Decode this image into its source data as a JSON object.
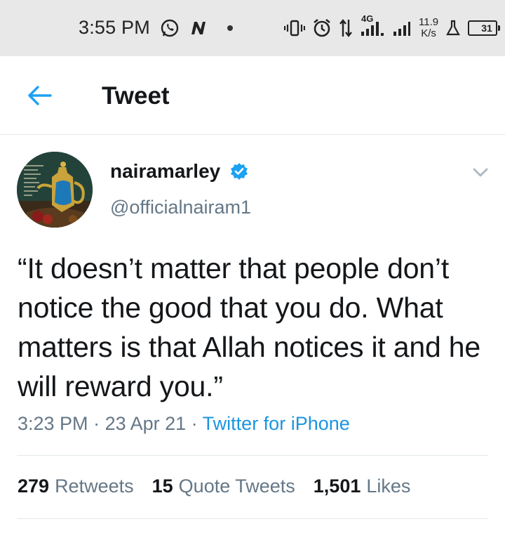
{
  "status_bar": {
    "time": "3:55 PM",
    "network_type": "4G",
    "speed_value": "11.9",
    "speed_unit": "K/s",
    "battery_level": "31",
    "icons": [
      "whatsapp-icon",
      "n-app-icon",
      "dot-icon",
      "vibrate-icon",
      "alarm-icon",
      "data-arrows-icon",
      "signal-icon",
      "signal-icon-2",
      "lab-icon",
      "battery-icon"
    ]
  },
  "header": {
    "title": "Tweet",
    "back_icon": "back-arrow-icon"
  },
  "tweet": {
    "display_name": "nairamarley",
    "verified": true,
    "handle": "@officialnairam1",
    "text": "“It doesn’t matter that people don’t notice the good that you do. What matters is that Allah notices it and he will reward you.”",
    "time": "3:23 PM",
    "sep1": " · ",
    "date": "23 Apr 21",
    "sep2": " · ",
    "source": "Twitter for iPhone"
  },
  "stats": {
    "retweets_count": "279",
    "retweets_label": "Retweets",
    "quotes_count": "15",
    "quotes_label": "Quote Tweets",
    "likes_count": "1,501",
    "likes_label": "Likes"
  },
  "colors": {
    "accent": "#1da1f2",
    "link": "#1b95e0",
    "secondary_text": "#657786",
    "status_bar_bg": "#e8e8e8"
  }
}
